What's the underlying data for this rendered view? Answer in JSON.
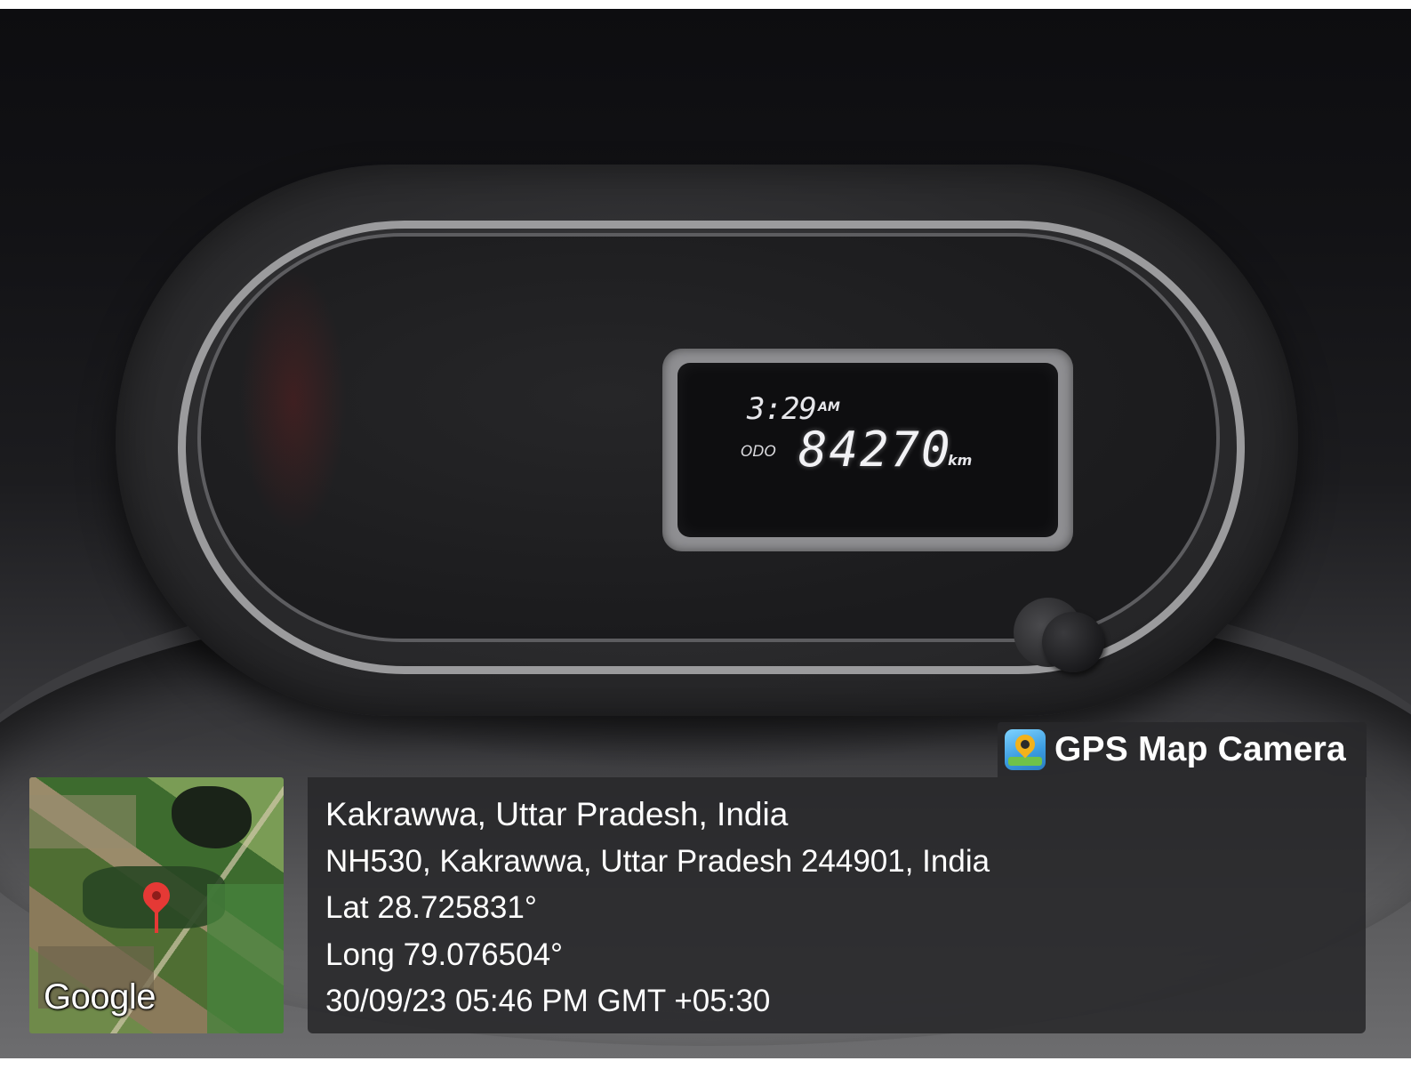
{
  "dashboard": {
    "clock_time": "3:29",
    "clock_ampm": "AM",
    "odometer_label": "ODO",
    "odometer_value": "84270",
    "odometer_unit": "km"
  },
  "overlay": {
    "brand_name": "GPS Map Camera",
    "brand_icon": "gps-map-camera-logo-icon",
    "map_provider": "Google",
    "location_title": "Kakrawwa, Uttar Pradesh, India",
    "address": "NH530, Kakrawwa, Uttar Pradesh 244901, India",
    "latitude": "Lat 28.725831°",
    "longitude": "Long 79.076504°",
    "timestamp": "30/09/23 05:46 PM GMT +05:30"
  },
  "colors": {
    "overlay_bg": "#28282a",
    "text": "#ffffff",
    "map_pin": "#e53935"
  }
}
